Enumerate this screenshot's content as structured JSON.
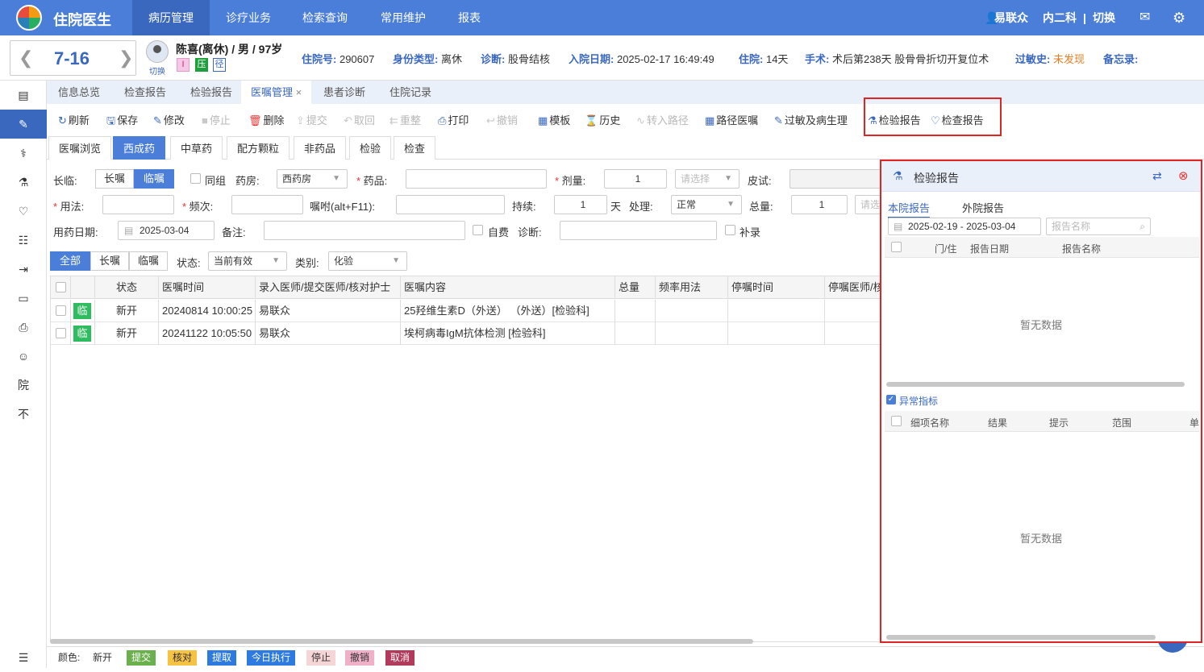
{
  "app": {
    "title": "住院医生"
  },
  "nav": [
    {
      "label": "病历管理",
      "active": true
    },
    {
      "label": "诊疗业务",
      "active": false
    },
    {
      "label": "检索查询",
      "active": false
    },
    {
      "label": "常用维护",
      "active": false
    },
    {
      "label": "报表",
      "active": false
    }
  ],
  "user": {
    "name": "易联众",
    "dept": "内二科",
    "switch": "切换",
    "sep": "|"
  },
  "patient": {
    "bed": "7-16",
    "name_line": "陈喜(离休) / 男 / 97岁",
    "switch_label": "切换",
    "badges": [
      "I",
      "压",
      "径"
    ],
    "fields": [
      {
        "label": "住院号:",
        "value": "290607"
      },
      {
        "label": "身份类型:",
        "value": "离休"
      },
      {
        "label": "诊断:",
        "value": "股骨结核"
      },
      {
        "label": "入院日期:",
        "value": "2025-02-17 16:49:49"
      },
      {
        "label": "住院:",
        "value": "14天"
      },
      {
        "label": "手术:",
        "value": "术后第238天 股骨骨折切开复位术"
      },
      {
        "label": "过敏史:",
        "value": "未发现"
      },
      {
        "label": "备忘录:",
        "value": ""
      }
    ]
  },
  "sidebar": [
    "▤",
    "✎",
    "⚕",
    "⚗",
    "♡",
    "☷",
    "⇥",
    "▭",
    "⎙",
    "☺",
    "院",
    "不",
    "☰"
  ],
  "tabs1": [
    {
      "label": "信息总览"
    },
    {
      "label": "检查报告"
    },
    {
      "label": "检验报告"
    },
    {
      "label": "医嘱管理",
      "close": "×"
    },
    {
      "label": "患者诊断"
    },
    {
      "label": "住院记录"
    }
  ],
  "toolbar": [
    {
      "icon": "↻",
      "label": "刷新"
    },
    {
      "icon": "🖫",
      "label": "保存"
    },
    {
      "icon": "✎",
      "label": "修改"
    },
    {
      "icon": "■",
      "label": "停止",
      "disabled": true
    },
    {
      "icon": "🗑",
      "label": "删除"
    },
    {
      "icon": "⇪",
      "label": "提交",
      "disabled": true
    },
    {
      "icon": "↶",
      "label": "取回",
      "disabled": true
    },
    {
      "icon": "⇇",
      "label": "重整",
      "disabled": true
    },
    {
      "icon": "⎙",
      "label": "打印"
    },
    {
      "icon": "↩",
      "label": "撤销",
      "disabled": true
    },
    {
      "icon": "▦",
      "label": "模板"
    },
    {
      "icon": "⌛",
      "label": "历史"
    },
    {
      "icon": "∿",
      "label": "转入路径",
      "disabled": true
    },
    {
      "icon": "▦",
      "label": "路径医嘱"
    },
    {
      "icon": "✎",
      "label": "过敏及病生理"
    },
    {
      "icon": "⚗",
      "label": "检验报告"
    },
    {
      "icon": "♡",
      "label": "检查报告"
    }
  ],
  "tabs2": [
    "医嘱浏览",
    "西成药",
    "中草药",
    "配方颗粒",
    "非药品",
    "检验",
    "检查"
  ],
  "form": {
    "changlin": "长临:",
    "changzhu": "长嘱",
    "linzhu": "临嘱",
    "tongzu": "同组",
    "yaofang": "药房:",
    "yaofang_val": "西药房",
    "yaopin": "药品:",
    "jiliang": "剂量:",
    "jiliang_val": "1",
    "qingxuanze": "请选择",
    "pishi": "皮试:",
    "yongfa": "用法:",
    "pinci": "频次:",
    "zhufu": "嘱咐(alt+F11):",
    "chixu": "持续:",
    "chixu_val": "1",
    "tian": "天",
    "chuli": "处理:",
    "chuli_val": "正常",
    "zongliang": "总量:",
    "zongliang_val": "1",
    "qingxuan_short": "请选",
    "yongyao_date": "用药日期:",
    "date_val": "2025-03-04",
    "beizhu": "备注:",
    "zifei": "自费",
    "zhenduan": "诊断:",
    "bulu": "补录"
  },
  "filter": {
    "all": "全部",
    "chang": "长嘱",
    "lin": "临嘱",
    "status_label": "状态:",
    "status_val": "当前有效",
    "type_label": "类别:",
    "type_val": "化验"
  },
  "grid": {
    "columns": [
      "",
      "",
      "状态",
      "医嘱时间",
      "录入医师/提交医师/核对护士",
      "医嘱内容",
      "总量",
      "频率用法",
      "停嘱时间",
      "停嘱医师/核"
    ],
    "rows": [
      {
        "badge": "临",
        "status": "新开",
        "time": "20240814 10:00:25",
        "doctor": "易联众",
        "content": "25羟维生素D（外送） （外送）[检验科]"
      },
      {
        "badge": "临",
        "status": "新开",
        "time": "20241122 10:05:50",
        "doctor": "易联众",
        "content": "埃柯病毒IgM抗体检测 [检验科]"
      }
    ]
  },
  "legend": {
    "label": "颜色:",
    "items": [
      {
        "label": "新开",
        "bg": "#ffffff",
        "fg": "#333333"
      },
      {
        "label": "提交",
        "bg": "#6ab04c",
        "fg": "#ffffff"
      },
      {
        "label": "核对",
        "bg": "#f6c244",
        "fg": "#333333"
      },
      {
        "label": "提取",
        "bg": "#2d7be0",
        "fg": "#ffffff"
      },
      {
        "label": "今日执行",
        "bg": "#2d7be0",
        "fg": "#ffffff"
      },
      {
        "label": "停止",
        "bg": "#f5d5d5",
        "fg": "#333333"
      },
      {
        "label": "撤销",
        "bg": "#f0b0c8",
        "fg": "#333333"
      },
      {
        "label": "取消",
        "bg": "#b33a5a",
        "fg": "#ffffff"
      }
    ]
  },
  "panel": {
    "title": "检验报告",
    "tab_in": "本院报告",
    "tab_out": "外院报告",
    "date_from": "2025-02-19",
    "date_to": "- 2025-03-04",
    "search_ph": "报告名称",
    "cols1": [
      "门/住",
      "报告日期",
      "报告名称"
    ],
    "empty1": "暂无数据",
    "abnormal": "异常指标",
    "cols2": [
      "细项名称",
      "结果",
      "提示",
      "范围",
      "单"
    ],
    "empty2": "暂无数据"
  },
  "colors": {
    "primary": "#4a7ed8",
    "highlight": "#e02424"
  }
}
